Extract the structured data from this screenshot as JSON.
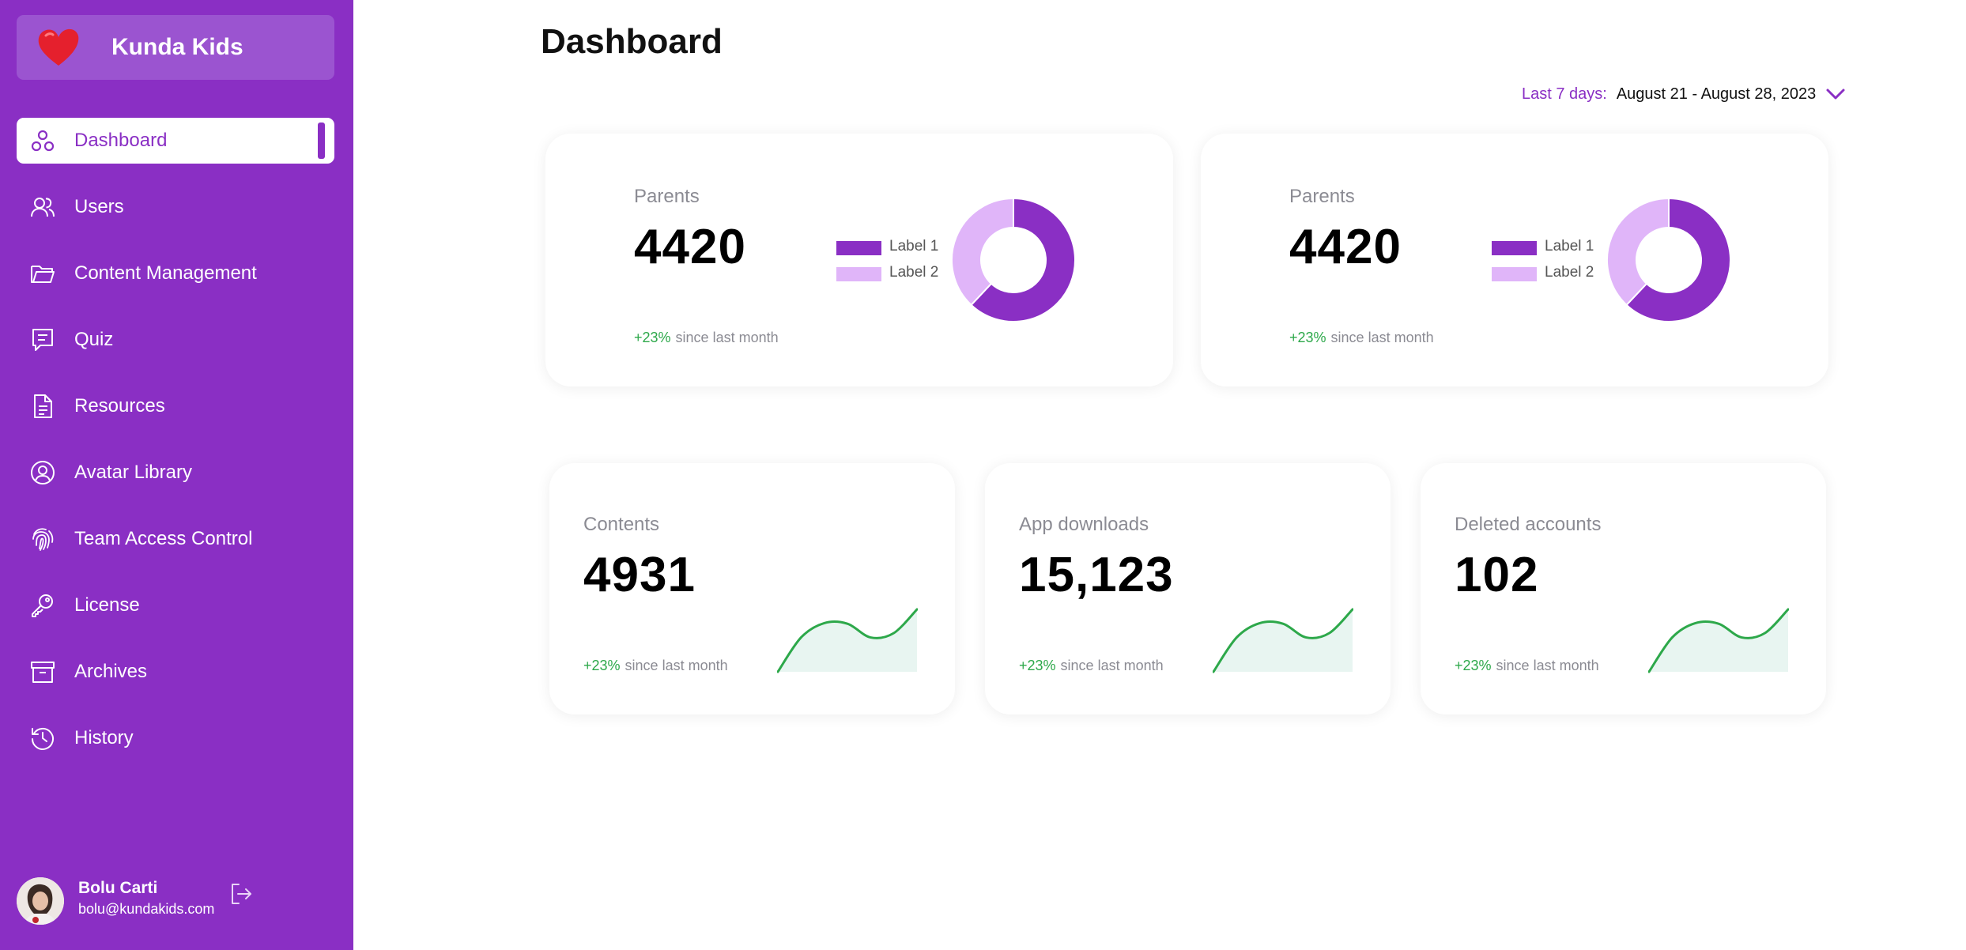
{
  "brand": {
    "name": "Kunda Kids"
  },
  "sidebar": {
    "items": [
      {
        "label": "Dashboard",
        "icon": "dashboard-icon",
        "active": true
      },
      {
        "label": "Users",
        "icon": "users-icon"
      },
      {
        "label": "Content Management",
        "icon": "folder-icon"
      },
      {
        "label": "Quiz",
        "icon": "quiz-icon"
      },
      {
        "label": "Resources",
        "icon": "document-icon"
      },
      {
        "label": "Avatar Library",
        "icon": "avatar-icon"
      },
      {
        "label": "Team Access Control",
        "icon": "fingerprint-icon"
      },
      {
        "label": "License",
        "icon": "key-icon"
      },
      {
        "label": "Archives",
        "icon": "archive-icon"
      },
      {
        "label": "History",
        "icon": "history-icon"
      }
    ]
  },
  "user": {
    "name": "Bolu Carti",
    "email": "bolu@kundakids.com"
  },
  "header": {
    "title": "Dashboard",
    "date_label": "Last 7 days:",
    "date_value": "August 21 - August 28, 2023"
  },
  "colors": {
    "primary": "#8a2fc4",
    "secondary": "#e0b5f9",
    "positive": "#2da84a"
  },
  "top_cards": [
    {
      "title": "Parents",
      "value": "4420",
      "delta": "+23%",
      "delta_text": "since last month",
      "chart_data": {
        "type": "pie",
        "donut": true,
        "categories": [
          "Label 1",
          "Label 2"
        ],
        "values": [
          62,
          38
        ],
        "colors": [
          "#8a2fc4",
          "#e0b5f9"
        ]
      }
    },
    {
      "title": "Parents",
      "value": "4420",
      "delta": "+23%",
      "delta_text": "since last month",
      "chart_data": {
        "type": "pie",
        "donut": true,
        "categories": [
          "Label 1",
          "Label 2"
        ],
        "values": [
          62,
          38
        ],
        "colors": [
          "#8a2fc4",
          "#e0b5f9"
        ]
      }
    }
  ],
  "bottom_cards": [
    {
      "title": "Contents",
      "value": "4931",
      "delta": "+23%",
      "delta_text": "since last month",
      "chart_data": {
        "type": "area",
        "values": [
          0,
          55,
          78,
          77,
          55,
          62,
          100
        ]
      }
    },
    {
      "title": "App downloads",
      "value": "15,123",
      "delta": "+23%",
      "delta_text": "since last month",
      "chart_data": {
        "type": "area",
        "values": [
          0,
          55,
          78,
          77,
          55,
          62,
          100
        ]
      }
    },
    {
      "title": "Deleted accounts",
      "value": "102",
      "delta": "+23%",
      "delta_text": "since last month",
      "chart_data": {
        "type": "area",
        "values": [
          0,
          55,
          78,
          77,
          55,
          62,
          100
        ]
      }
    }
  ]
}
